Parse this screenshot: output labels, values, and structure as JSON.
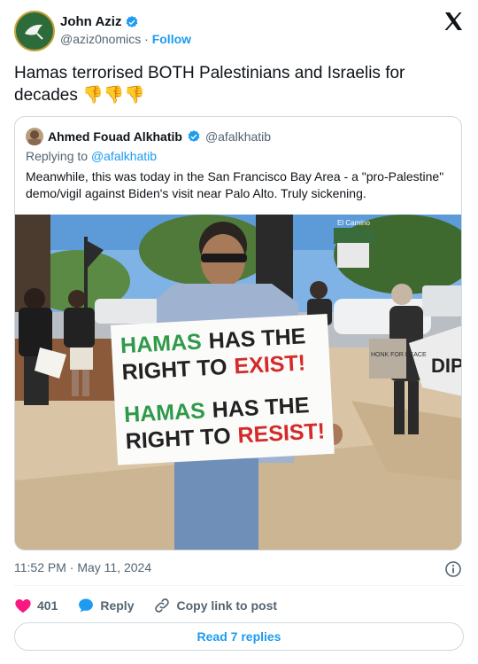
{
  "author": {
    "name": "John Aziz",
    "handle": "@aziz0nomics",
    "separator": "·",
    "follow_label": "Follow"
  },
  "tweet": {
    "text": "Hamas terrorised BOTH Palestinians and Israelis for decades 👎👎👎"
  },
  "quoted": {
    "name": "Ahmed Fouad Alkhatib",
    "handle": "@afalkhatib",
    "replying_prefix": "Replying to ",
    "replying_to": "@afalkhatib",
    "text": "Meanwhile, this was today in the San Francisco Bay Area - a \"pro-Palestine\" demo/vigil against Biden's visit near Palo Alto. Truly sickening.",
    "photo": {
      "sign_line1a": "HAMAS",
      "sign_line1b": "HAS THE",
      "sign_line2a": "RIGHT TO",
      "sign_line2b": "EXIST!",
      "sign_line3a": "HAMAS",
      "sign_line3b": "HAS THE",
      "sign_line4a": "RIGHT TO",
      "sign_line4b": "RESIST!",
      "street_sign": "El Camino",
      "small_sign": "HONK FOR PEACE",
      "banner": "DIP"
    }
  },
  "timestamp": "11:52 PM · May 11, 2024",
  "actions": {
    "likes": "401",
    "reply_label": "Reply",
    "copy_label": "Copy link to post"
  },
  "read_replies_label": "Read 7 replies",
  "colors": {
    "accent": "#1d9bf0",
    "like": "#f91880",
    "text": "#0f1419",
    "muted": "#536471"
  }
}
